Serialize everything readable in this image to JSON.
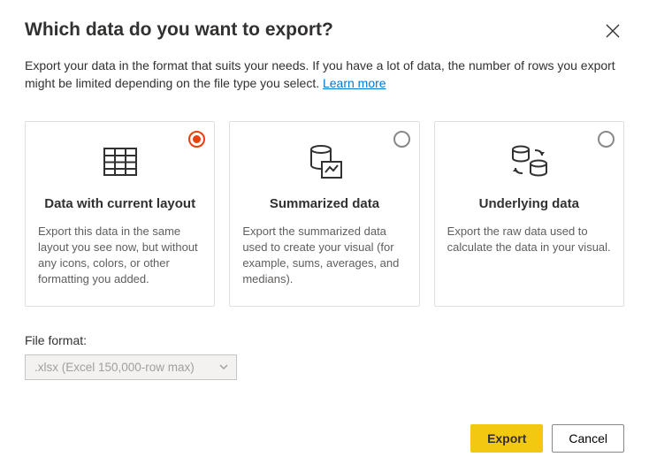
{
  "dialog": {
    "title": "Which data do you want to export?",
    "description": "Export your data in the format that suits your needs. If you have a lot of data, the number of rows you export might be limited depending on the file type you select.  ",
    "learn_more": "Learn more"
  },
  "options": [
    {
      "title": "Data with current layout",
      "description": "Export this data in the same layout you see now, but without any icons, colors, or other formatting you added.",
      "selected": true
    },
    {
      "title": "Summarized data",
      "description": "Export the summarized data used to create your visual (for example, sums, averages, and medians).",
      "selected": false
    },
    {
      "title": "Underlying data",
      "description": "Export the raw data used to calculate the data in your visual.",
      "selected": false
    }
  ],
  "file_format": {
    "label": "File format:",
    "selected": ".xlsx (Excel 150,000-row max)"
  },
  "buttons": {
    "export": "Export",
    "cancel": "Cancel"
  }
}
